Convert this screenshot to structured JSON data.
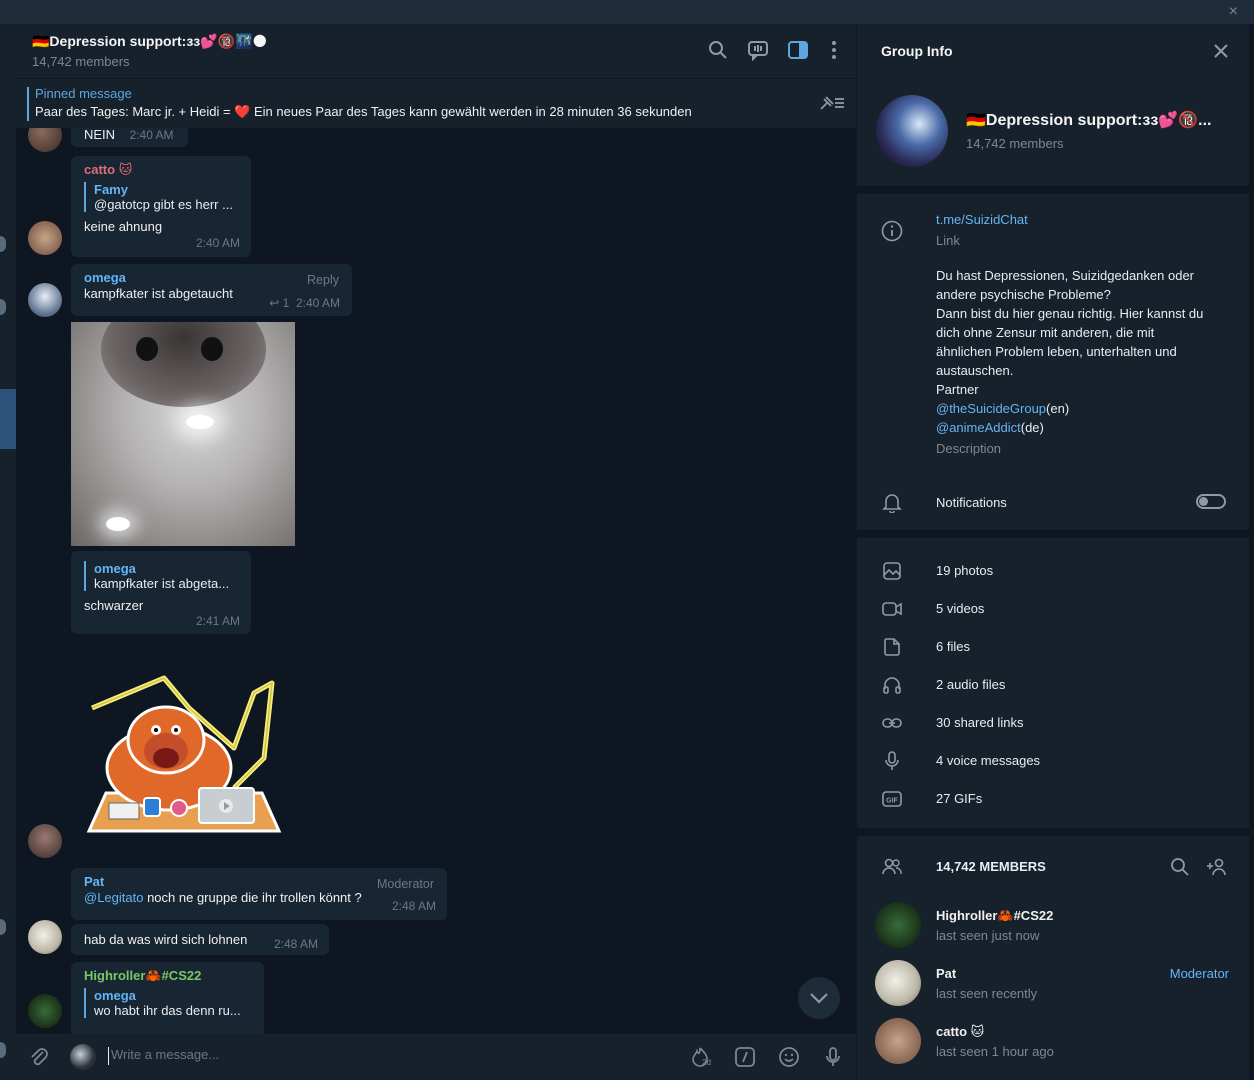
{
  "window": {
    "close_glyph": "×"
  },
  "header": {
    "title": "🇩🇪Depression support:ɜɜ💕🔞🌃🌑",
    "members": "14,742 members"
  },
  "pinned": {
    "label": "Pinned message",
    "text_before": "Paar des Tages: Marc jr. + Heidi = ",
    "heart": "❤️",
    "text_after": " Ein neues Paar des Tages kann gewählt werden in 28 minuten 36 sekunden"
  },
  "messages": {
    "m0": {
      "text": "NEIN",
      "time": "2:40 AM"
    },
    "m1": {
      "name": "catto",
      "name_emoji": "🐱",
      "reply_name": "Famy",
      "reply_text": "@gatotcp gibt es herr ...",
      "text": "keine ahnung",
      "time": "2:40 AM"
    },
    "m2": {
      "name": "omega",
      "badge": "Reply",
      "text": "kampfkater ist abgetaucht",
      "replies": "1",
      "time": "2:40 AM"
    },
    "m3": {
      "reply_name": "omega",
      "reply_text": "kampfkater ist abgeta...",
      "text": "schwarzer",
      "time": "2:41 AM"
    },
    "m4": {
      "name": "Pat",
      "badge": "Moderator",
      "mention": "@Legitato",
      "text": " noch ne gruppe die ihr trollen könnt ?",
      "time": "2:48 AM"
    },
    "m5": {
      "text": "hab da was wird sich lohnen",
      "time": "2:48 AM"
    },
    "m6": {
      "name": "Highroller🦀#CS22",
      "reply_name": "omega",
      "reply_text": "wo habt ihr das denn ru..."
    }
  },
  "composer": {
    "placeholder": "Write a message...",
    "timer": "2d"
  },
  "panel": {
    "title": "Group Info",
    "group_name": "🇩🇪Depression support:ɜɜ💕🔞...",
    "members": "14,742 members",
    "link": "t.me/SuizidChat",
    "link_label": "Link",
    "description_lines": [
      "Du hast Depressionen, Suizidgedanken oder",
      "andere psychische Probleme?",
      "Dann bist du hier genau richtig. Hier kannst du",
      "dich ohne Zensur mit anderen, die mit",
      "ähnlichen Problem leben, unterhalten und",
      "austauschen.",
      "Partner"
    ],
    "partner1": "@theSuicideGroup",
    "partner1_lang": "(en)",
    "partner2": "@animeAddict",
    "partner2_lang": "(de)",
    "description_label": "Description",
    "notifications": "Notifications",
    "notifications_on": false,
    "media": {
      "photos": "19 photos",
      "videos": "5 videos",
      "files": "6 files",
      "audio": "2 audio files",
      "links": "30 shared links",
      "voice": "4 voice messages",
      "gifs": "27 GIFs"
    },
    "members_header": "14,742 MEMBERS",
    "member_list": [
      {
        "name": "Highroller🦀#CS22",
        "status": "last seen just now",
        "role": ""
      },
      {
        "name": "Pat",
        "status": "last seen recently",
        "role": "Moderator"
      },
      {
        "name": "catto 🐱",
        "status": "last seen 1 hour ago",
        "role": ""
      }
    ]
  },
  "colors": {
    "accent": "#64b5f6",
    "bubble": "#182533",
    "bg": "#0e1621",
    "panel": "#17212b",
    "catto_name": "#e06c75",
    "highroller_name": "#7bc862"
  }
}
